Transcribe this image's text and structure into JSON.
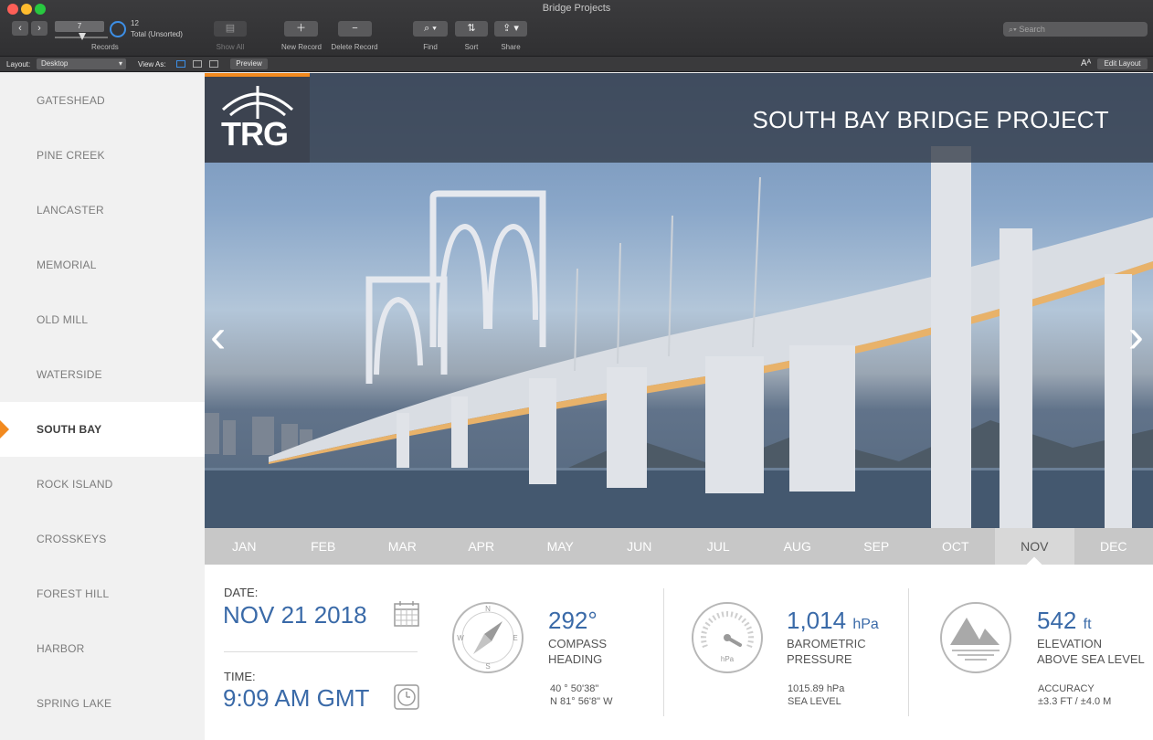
{
  "window": {
    "title": "Bridge Projects"
  },
  "toolbar": {
    "record_number": "7",
    "records_label": "Records",
    "record_count": "12",
    "record_total": "Total (Unsorted)",
    "show_all_label": "Show All",
    "new_record_label": "New Record",
    "delete_record_label": "Delete Record",
    "find_label": "Find",
    "sort_label": "Sort",
    "share_label": "Share",
    "search_placeholder": "Search"
  },
  "layout_bar": {
    "layout_label": "Layout:",
    "layout_value": "Desktop",
    "view_as_label": "View As:",
    "preview_label": "Preview",
    "text_size_glyph": "Aᴬ",
    "edit_layout_label": "Edit Layout"
  },
  "sidebar": {
    "items": [
      {
        "label": "GATESHEAD"
      },
      {
        "label": "PINE CREEK"
      },
      {
        "label": "LANCASTER"
      },
      {
        "label": "MEMORIAL"
      },
      {
        "label": "OLD MILL"
      },
      {
        "label": "WATERSIDE"
      },
      {
        "label": "SOUTH BAY"
      },
      {
        "label": "ROCK ISLAND"
      },
      {
        "label": "CROSSKEYS"
      },
      {
        "label": "FOREST HILL"
      },
      {
        "label": "HARBOR"
      },
      {
        "label": "SPRING LAKE"
      }
    ],
    "active_index": 6
  },
  "hero": {
    "logo_text": "TRG",
    "title": "SOUTH BAY BRIDGE PROJECT"
  },
  "months": [
    "JAN",
    "FEB",
    "MAR",
    "APR",
    "MAY",
    "JUN",
    "JUL",
    "AUG",
    "SEP",
    "OCT",
    "NOV",
    "DEC"
  ],
  "active_month": "NOV",
  "details": {
    "date_label": "DATE:",
    "date_value": "NOV 21 2018",
    "time_label": "TIME:",
    "time_value": "9:09 AM GMT",
    "compass": {
      "value": "292°",
      "label_1": "COMPASS",
      "label_2": "HEADING",
      "lat": "40 ° 50'38\"",
      "lon": "N 81° 56'8\" W",
      "n": "N",
      "e": "E",
      "s": "S",
      "w": "W"
    },
    "pressure": {
      "value": "1,014",
      "unit": "hPa",
      "label_1": "BAROMETRIC",
      "label_2": "PRESSURE",
      "sea_value": "1015.89 hPa",
      "sea_label": "SEA LEVEL",
      "gauge_unit": "hPa"
    },
    "elevation": {
      "value": "542",
      "unit": "ft",
      "label_1": "ELEVATION",
      "label_2": "ABOVE SEA LEVEL",
      "accuracy_label": "ACCURACY",
      "accuracy_value": "±3.3 FT / ±4.0 M"
    }
  },
  "colors": {
    "accent": "#f28a1f",
    "blue": "#3a6aa8"
  }
}
